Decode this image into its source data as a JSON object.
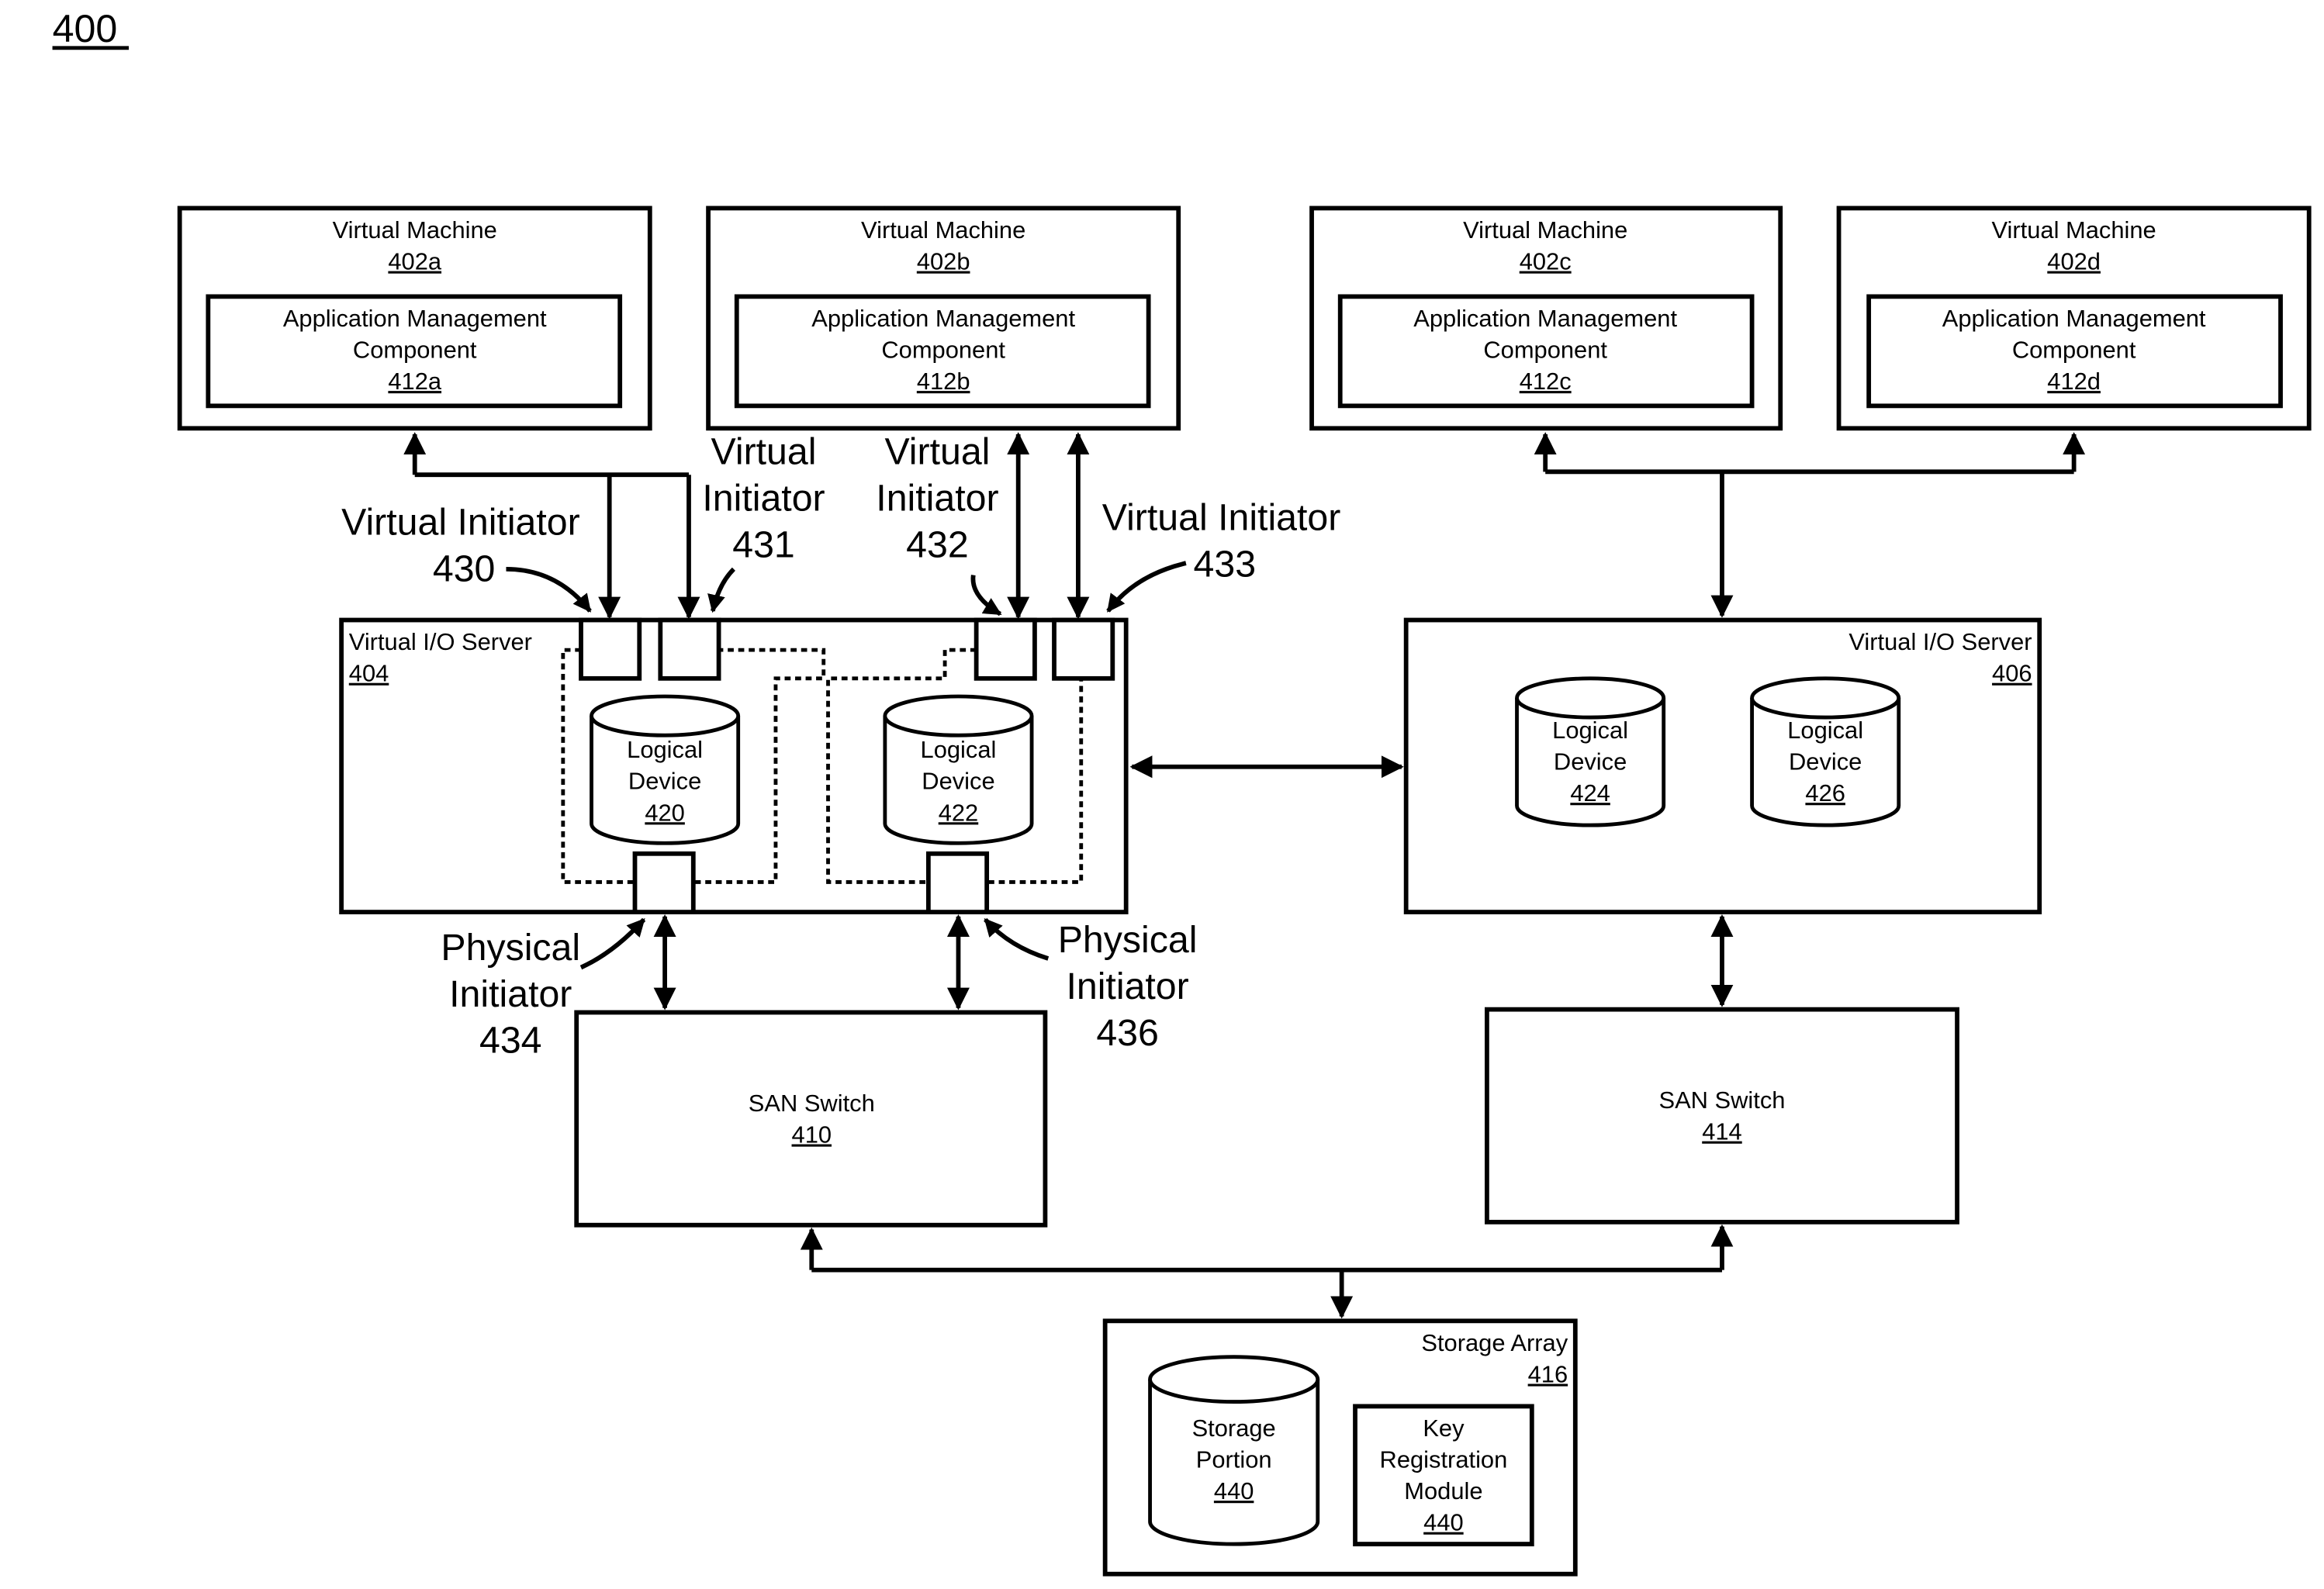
{
  "figure_label": "400",
  "virtual_machines": [
    {
      "title": "Virtual Machine",
      "ref": "402a",
      "component": {
        "line1": "Application Management",
        "line2": "Component",
        "ref": "412a"
      }
    },
    {
      "title": "Virtual Machine",
      "ref": "402b",
      "component": {
        "line1": "Application Management",
        "line2": "Component",
        "ref": "412b"
      }
    },
    {
      "title": "Virtual Machine",
      "ref": "402c",
      "component": {
        "line1": "Application Management",
        "line2": "Component",
        "ref": "412c"
      }
    },
    {
      "title": "Virtual Machine",
      "ref": "402d",
      "component": {
        "line1": "Application Management",
        "line2": "Component",
        "ref": "412d"
      }
    }
  ],
  "vios": [
    {
      "title": "Virtual I/O Server",
      "ref": "404"
    },
    {
      "title": "Virtual I/O Server",
      "ref": "406"
    }
  ],
  "logical_devices": [
    {
      "line1": "Logical",
      "line2": "Device",
      "ref": "420"
    },
    {
      "line1": "Logical",
      "line2": "Device",
      "ref": "422"
    },
    {
      "line1": "Logical",
      "line2": "Device",
      "ref": "424"
    },
    {
      "line1": "Logical",
      "line2": "Device",
      "ref": "426"
    }
  ],
  "virtual_initiators": [
    {
      "line1": "Virtual Initiator",
      "ref": "430"
    },
    {
      "line1": "Virtual",
      "line2": "Initiator",
      "ref": "431"
    },
    {
      "line1": "Virtual",
      "line2": "Initiator",
      "ref": "432"
    },
    {
      "line1": "Virtual Initiator",
      "ref": "433"
    }
  ],
  "physical_initiators": [
    {
      "line1": "Physical",
      "line2": "Initiator",
      "ref": "434"
    },
    {
      "line1": "Physical",
      "line2": "Initiator",
      "ref": "436"
    }
  ],
  "san_switches": [
    {
      "title": "SAN Switch",
      "ref": "410"
    },
    {
      "title": "SAN Switch",
      "ref": "414"
    }
  ],
  "storage_array": {
    "title": "Storage Array",
    "ref": "416",
    "storage_portion": {
      "line1": "Storage",
      "line2": "Portion",
      "ref": "440"
    },
    "key_module": {
      "line1": "Key",
      "line2": "Registration",
      "line3": "Module",
      "ref": "440"
    }
  }
}
